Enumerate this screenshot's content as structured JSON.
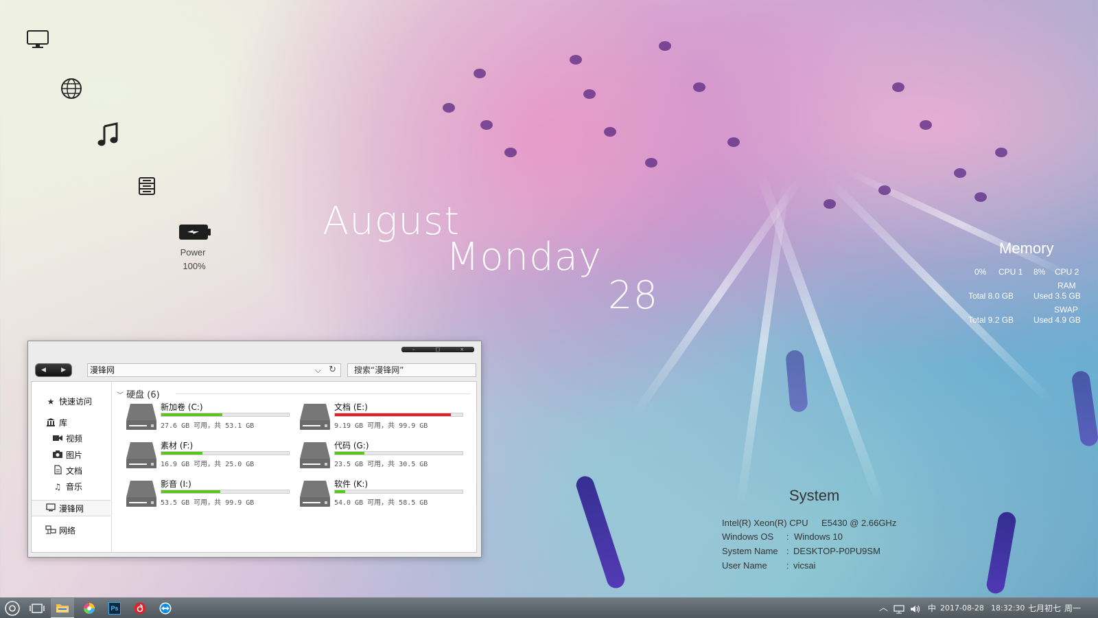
{
  "desktop": {
    "icons": [
      {
        "name": "monitor-icon"
      },
      {
        "name": "globe-icon"
      },
      {
        "name": "music-icon"
      },
      {
        "name": "drive-icon"
      },
      {
        "name": "battery-icon"
      }
    ],
    "power": {
      "label": "Power",
      "value": "100%",
      "level": 100
    }
  },
  "date_widget": {
    "month": "August",
    "weekday": "Monday",
    "day": "28"
  },
  "memory_widget": {
    "title": "Memory",
    "cpu1_value": "0%",
    "cpu1_label": "CPU 1",
    "cpu2_value": "8%",
    "cpu2_label": "CPU 2",
    "ram_label": "RAM",
    "ram_total": "Total 8.0 GB",
    "ram_used": "Used 3.5 GB",
    "swap_label": "SWAP",
    "swap_total": "Total 9.2 GB",
    "swap_used": "Used 4.9 GB"
  },
  "system_widget": {
    "title": "System",
    "rows": [
      {
        "label": "Intel(R) Xeon(R) CPU",
        "sep": "",
        "value": "E5430  @ 2.66GHz"
      },
      {
        "label": "Windows OS",
        "sep": ":",
        "value": "Windows 10"
      },
      {
        "label": "System Name",
        "sep": ":",
        "value": "DESKTOP-P0PU9SM"
      },
      {
        "label": "User Name",
        "sep": ":",
        "value": "vicsai"
      }
    ]
  },
  "explorer": {
    "window_controls": {
      "minimize": "–",
      "maximize": "□",
      "close": "×"
    },
    "nav_back": "◀",
    "nav_forward": "▶",
    "address": "漫锋网",
    "address_chevron": "⌵",
    "refresh": "↻",
    "search_placeholder": "搜索“漫锋网”",
    "nav_pane": {
      "quick_access": "快速访问",
      "library": "库",
      "videos": "视频",
      "pictures": "图片",
      "documents": "文档",
      "music": "音乐",
      "this_pc": "漫锋网",
      "network": "网络"
    },
    "group_header": "硬盘 (6)",
    "drives": [
      {
        "name": "新加卷 (C:)",
        "info": "27.6 GB 可用，共 53.1 GB",
        "used_fraction": 0.48,
        "color": "#5cc41e"
      },
      {
        "name": "文档 (E:)",
        "info": "9.19 GB 可用，共 99.9 GB",
        "used_fraction": 0.91,
        "color": "#d8232a"
      },
      {
        "name": "素材 (F:)",
        "info": "16.9 GB 可用，共 25.0 GB",
        "used_fraction": 0.32,
        "color": "#5cc41e"
      },
      {
        "name": "代码 (G:)",
        "info": "23.5 GB 可用，共 30.5 GB",
        "used_fraction": 0.23,
        "color": "#5cc41e"
      },
      {
        "name": "影音 (I:)",
        "info": "53.5 GB 可用，共 99.9 GB",
        "used_fraction": 0.46,
        "color": "#5cc41e"
      },
      {
        "name": "软件 (K:)",
        "info": "54.0 GB 可用，共 58.5 GB",
        "used_fraction": 0.08,
        "color": "#5cc41e"
      }
    ]
  },
  "taskbar": {
    "apps": [
      {
        "name": "start-icon"
      },
      {
        "name": "task-view-icon"
      },
      {
        "name": "file-explorer-icon"
      },
      {
        "name": "color-picker-icon"
      },
      {
        "name": "photoshop-icon",
        "label": "Ps"
      },
      {
        "name": "netease-music-icon"
      },
      {
        "name": "teamviewer-icon"
      }
    ],
    "tray": {
      "ime": "中",
      "date": "2017-08-28",
      "time": "18:32:30",
      "lunar": "七月初七",
      "weekday": "周一"
    }
  }
}
